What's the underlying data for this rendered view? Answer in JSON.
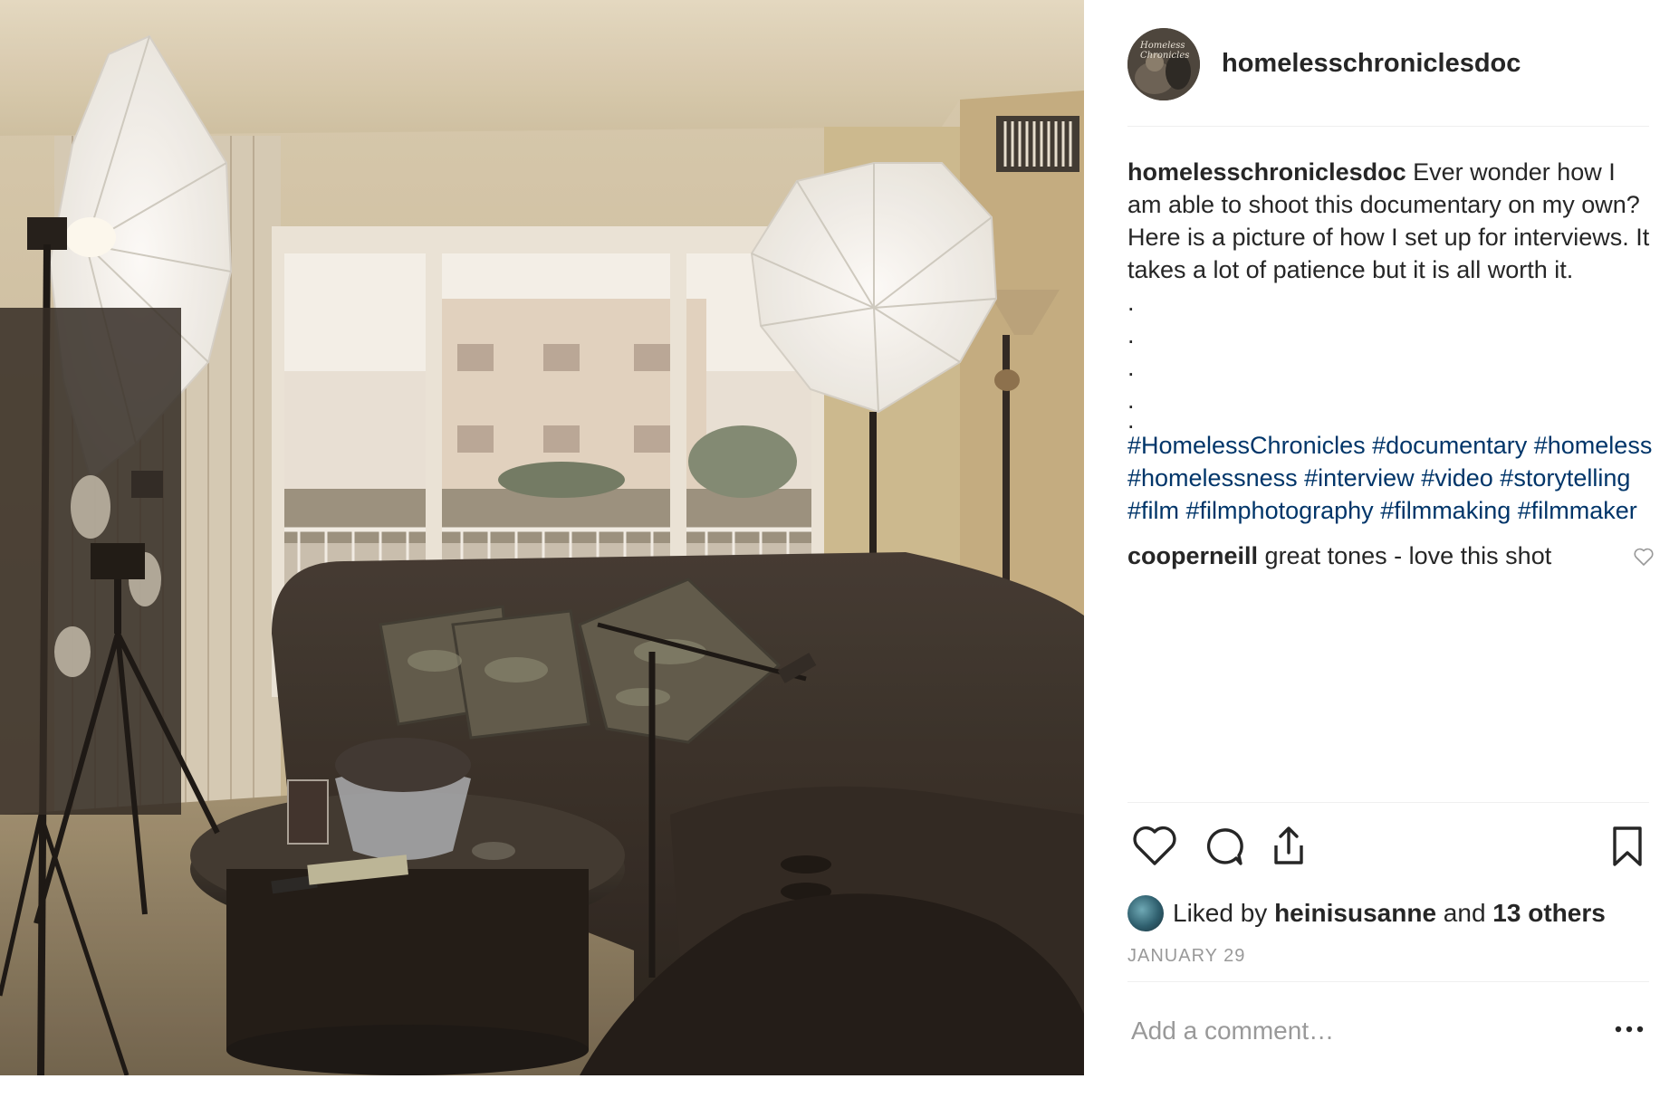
{
  "post": {
    "username": "homelesschroniclesdoc",
    "avatar_text": "Homeless Chronicles",
    "caption_user": "homelesschroniclesdoc",
    "caption_text": "Ever wonder how I am able to shoot this documentary on my own? Here is a picture of how I set up for interviews. It takes a lot of patience but it is all worth it.",
    "dots": [
      ".",
      ".",
      ".",
      ".",
      "."
    ],
    "hashtags": [
      "#HomelessChronicles",
      "#documentary",
      "#homeless",
      "#homelessness",
      "#interview",
      "#video",
      "#storytelling",
      "#film",
      "#filmphotography",
      "#filmmaking",
      "#filmmaker"
    ],
    "comment": {
      "user": "cooperneill",
      "text": "great tones - love this shot"
    },
    "likes": {
      "prefix": "Liked by",
      "user": "heinisusanne",
      "and": "and",
      "others": "13 others"
    },
    "date": "JANUARY 29",
    "comment_placeholder": "Add a comment…"
  },
  "icons": {
    "like": "heart-icon",
    "comment": "comment-icon",
    "share": "share-icon",
    "save": "bookmark-icon",
    "more": "more-icon",
    "comment_like": "heart-icon"
  },
  "colors": {
    "text": "#262626",
    "hashtag": "#003569",
    "muted": "#999999",
    "divider": "#efefef"
  }
}
